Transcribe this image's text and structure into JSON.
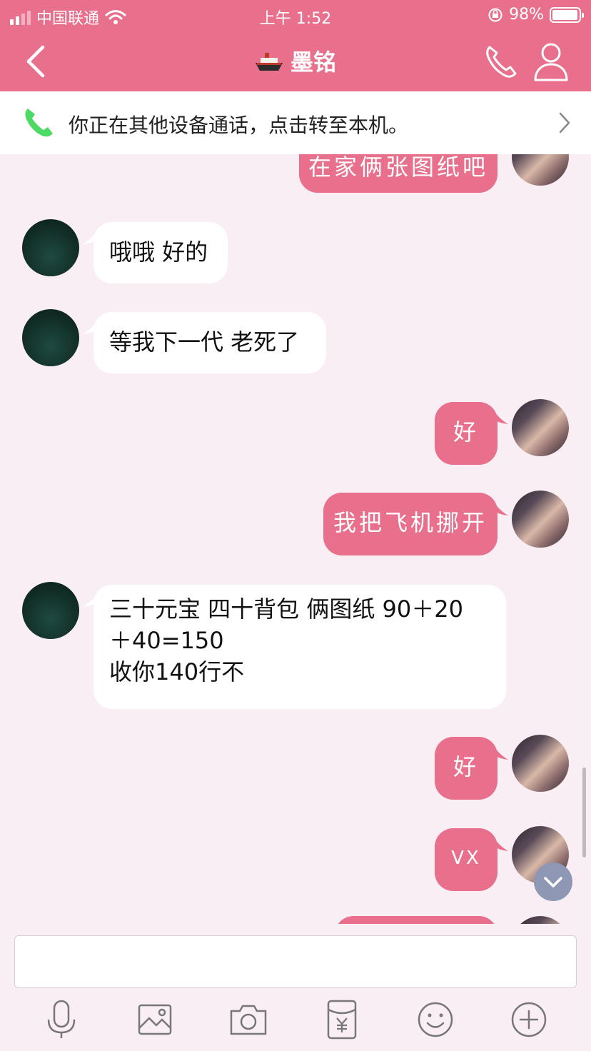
{
  "status_bar": {
    "carrier": "中国联通",
    "time": "上午 1:52",
    "battery": "98%"
  },
  "nav": {
    "title": "墨铭",
    "title_icon": "ship-emoji"
  },
  "call_banner": {
    "text": "你正在其他设备通话，点击转至本机。"
  },
  "messages": [
    {
      "side": "out",
      "text": "在家俩张图纸吧"
    },
    {
      "side": "in",
      "text": "哦哦 好的"
    },
    {
      "side": "in",
      "text": "等我下一代 老死了"
    },
    {
      "side": "out",
      "text": "好"
    },
    {
      "side": "out",
      "text": "我把飞机挪开"
    },
    {
      "side": "in",
      "lines": [
        "三十元宝 四十背包 俩图纸 90＋20",
        "＋40=150",
        "收你140行不"
      ]
    },
    {
      "side": "out",
      "text": "好"
    },
    {
      "side": "out",
      "text": "VX"
    }
  ],
  "toolbar": {
    "items": [
      "microphone-icon",
      "image-icon",
      "camera-icon",
      "red-packet-icon",
      "emoji-icon",
      "plus-icon"
    ]
  },
  "colors": {
    "accent": "#e8708c",
    "background": "#f9eef3",
    "incoming_bubble": "#ffffff",
    "call_green": "#4cd964",
    "scroll_button": "#8e98b5"
  }
}
